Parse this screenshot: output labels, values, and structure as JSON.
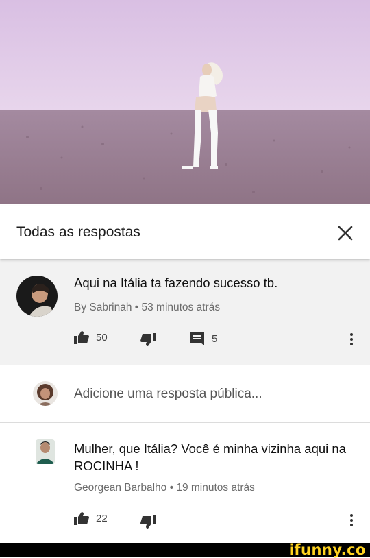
{
  "video": {
    "progress_fraction": 0.4
  },
  "header": {
    "title": "Todas as respostas",
    "close_icon": "close-icon"
  },
  "parent_comment": {
    "text": "Aqui na Itália ta fazendo sucesso tb.",
    "meta": "By Sabrinah • 53 minutos atrás",
    "likes": "50",
    "replies": "5"
  },
  "reply_box": {
    "placeholder": "Adicione uma resposta pública..."
  },
  "reply_comment": {
    "text": "Mulher, que Itália? Você é minha vizinha aqui na ROCINHA !",
    "meta": "Georgean Barbalho • 19 minutos atrás",
    "likes": "22"
  },
  "watermark": {
    "text": "ifunny.co"
  },
  "colors": {
    "accent": "#e1131f",
    "watermark": "#ffd21e"
  }
}
